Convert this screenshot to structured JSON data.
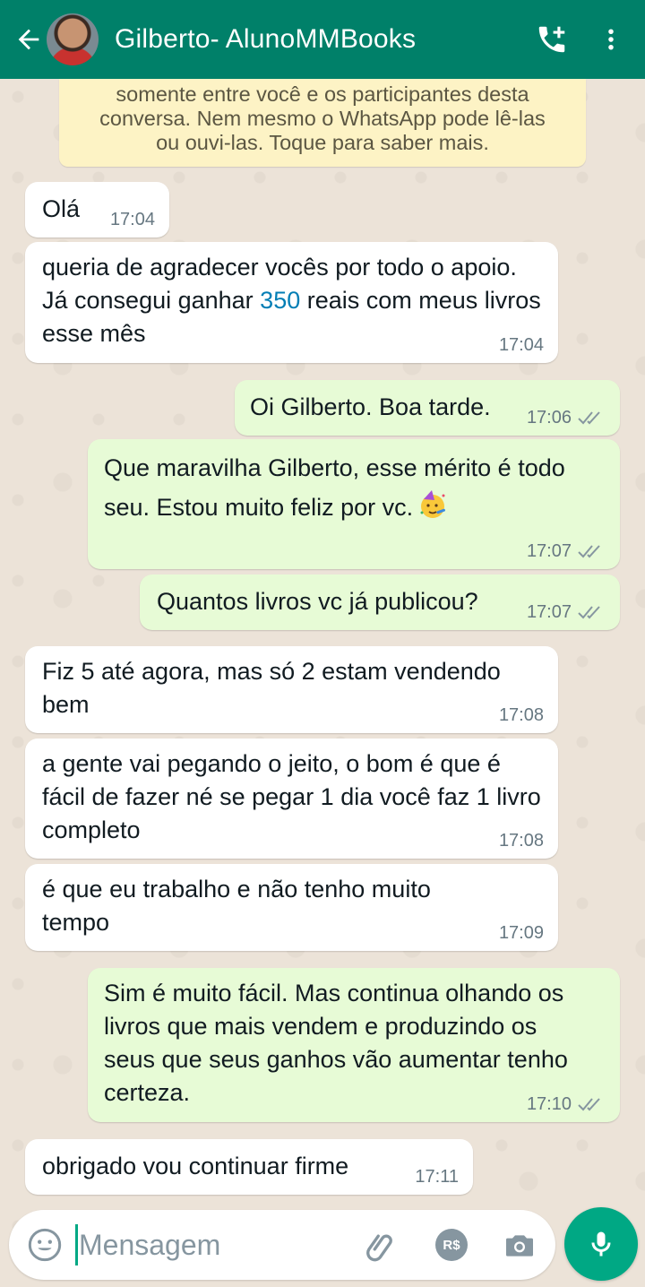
{
  "header": {
    "contact_name": "Gilberto- AlunoMMBooks",
    "icons": [
      "back-arrow-icon",
      "add-call-icon",
      "more-vertical-icon"
    ],
    "color": "#008069"
  },
  "notice": {
    "line1": "somente entre você e os participantes desta",
    "line2": "conversa. Nem mesmo o WhatsApp pode lê-las",
    "line3": "ou ouvi-las. Toque para saber mais."
  },
  "messages": [
    {
      "dir": "in",
      "text": "Olá",
      "time": "17:04"
    },
    {
      "dir": "in",
      "text_before": "queria de agradecer vocês por todo o apoio. Já consegui ganhar ",
      "number": "350",
      "text_after": " reais com meus livros esse mês",
      "time": "17:04"
    },
    {
      "dir": "out",
      "text": "Oi Gilberto. Boa tarde.",
      "time": "17:06",
      "status": "read"
    },
    {
      "dir": "out",
      "text": "Que maravilha Gilberto, esse mérito é todo seu. Estou muito feliz por vc.",
      "emoji": "partying-face",
      "time": "17:07",
      "status": "read"
    },
    {
      "dir": "out",
      "text": "Quantos livros vc já publicou?",
      "time": "17:07",
      "status": "read"
    },
    {
      "dir": "in",
      "text": "Fiz 5 até agora, mas só 2 estam vendendo bem",
      "time": "17:08"
    },
    {
      "dir": "in",
      "text": "a gente vai pegando o jeito, o bom é que é fácil de fazer né se pegar 1 dia você faz 1 livro completo",
      "time": "17:08"
    },
    {
      "dir": "in",
      "text": "é que eu trabalho e não tenho muito tempo",
      "time": "17:09"
    },
    {
      "dir": "out",
      "text": "Sim é muito fácil. Mas continua olhando os livros que mais vendem e produzindo os seus que seus ganhos vão aumentar tenho certeza.",
      "time": "17:10",
      "status": "read"
    },
    {
      "dir": "in",
      "text": "obrigado vou continuar firme",
      "time": "17:11"
    }
  ],
  "composer": {
    "placeholder": "Mensagem",
    "pay_label": "R$",
    "icons": [
      "emoji-icon",
      "attach-icon",
      "payment-icon",
      "camera-icon",
      "mic-icon"
    ],
    "accent": "#00a884"
  },
  "colors": {
    "incoming_bubble": "#ffffff",
    "outgoing_bubble": "#e7fbd6",
    "number_link": "#027eb5"
  }
}
